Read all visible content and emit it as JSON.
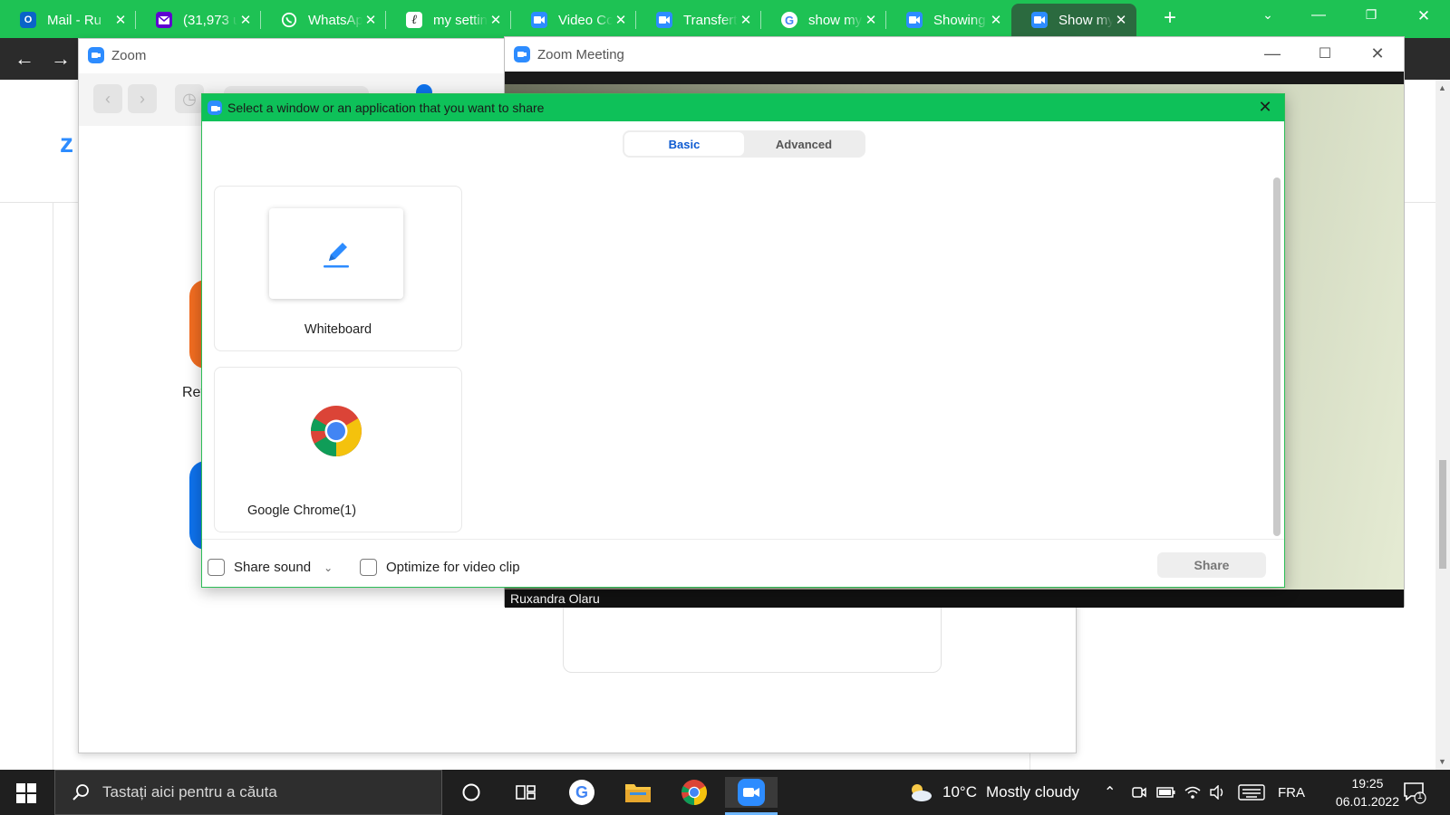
{
  "browser": {
    "tabs": [
      {
        "title": "Mail - Ru",
        "icon": "outlook-icon",
        "color": "#0a64c8",
        "active": false
      },
      {
        "title": "(31,973 u",
        "icon": "yahoo-mail-icon",
        "color": "#5f01d1",
        "active": false
      },
      {
        "title": "WhatsApp",
        "icon": "whatsapp-icon",
        "color": "#25d366",
        "active": false
      },
      {
        "title": "my settin",
        "icon": "script-l-icon",
        "color": "#333333",
        "active": false
      },
      {
        "title": "Video Co",
        "icon": "zoom-icon",
        "color": "#2d8cff",
        "active": false
      },
      {
        "title": "Transfert",
        "icon": "zoom-icon",
        "color": "#2d8cff",
        "active": false
      },
      {
        "title": "show my",
        "icon": "google-icon",
        "color": "#4285f4",
        "active": false
      },
      {
        "title": "Showing",
        "icon": "zoom-icon",
        "color": "#2d8cff",
        "active": false
      },
      {
        "title": "Show my",
        "icon": "zoom-icon",
        "color": "#2d8cff",
        "active": true
      }
    ],
    "new_tab_symbol": "+",
    "close_symbol": "✕"
  },
  "zoom_home": {
    "title": "Zoom",
    "tile_label": "Ret"
  },
  "meeting": {
    "title": "Zoom Meeting",
    "participant_name": "Ruxandra Olaru"
  },
  "share_dialog": {
    "title": "Select a window or an application that you want to share",
    "tabs": {
      "basic": "Basic",
      "advanced": "Advanced"
    },
    "apps": [
      {
        "name": "Whiteboard",
        "icon": "whiteboard-pen-icon"
      },
      {
        "name": "Google Chrome(1)",
        "icon": "chrome-icon"
      }
    ],
    "share_sound_label": "Share sound",
    "optimize_label": "Optimize for video clip",
    "share_button": "Share",
    "accent": "#0ec159"
  },
  "taskbar": {
    "search_placeholder": "Tastați aici pentru a căuta",
    "temperature": "10°C",
    "weather": "Mostly cloudy",
    "language": "FRA",
    "time": "19:25",
    "date": "06.01.2022",
    "notification_count": "1"
  }
}
